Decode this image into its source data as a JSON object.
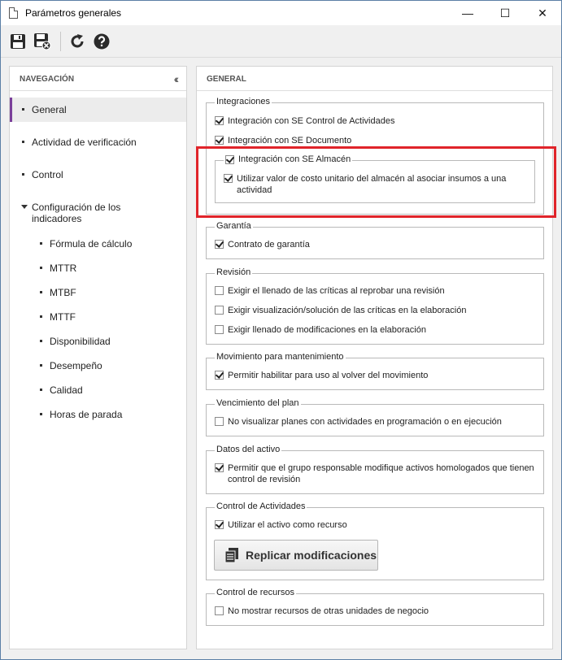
{
  "window": {
    "title": "Parámetros generales",
    "min": "—",
    "max": "☐",
    "close": "✕"
  },
  "toolbar": {
    "save": "save-icon",
    "save_close": "save-close-icon",
    "refresh": "refresh-icon",
    "help": "help-icon"
  },
  "nav": {
    "header": "NAVEGACIÓN",
    "collapse": "«",
    "items": [
      {
        "label": "General"
      },
      {
        "label": "Actividad de verificación"
      },
      {
        "label": "Control"
      },
      {
        "label": "Configuración de los indicadores"
      }
    ],
    "subitems": [
      {
        "label": "Fórmula de cálculo"
      },
      {
        "label": "MTTR"
      },
      {
        "label": "MTBF"
      },
      {
        "label": "MTTF"
      },
      {
        "label": "Disponibilidad"
      },
      {
        "label": "Desempeño"
      },
      {
        "label": "Calidad"
      },
      {
        "label": "Horas de parada"
      }
    ]
  },
  "main": {
    "header": "GENERAL",
    "integraciones": {
      "legend": "Integraciones",
      "items": [
        {
          "label": "Integración con SE Control de Actividades",
          "checked": true
        },
        {
          "label": "Integración con SE Documento",
          "checked": true
        }
      ],
      "almacen": {
        "legend": "Integración con SE Almacén",
        "checked": true,
        "item": {
          "label": "Utilizar valor de costo unitario del almacén al asociar insumos a una actividad",
          "checked": true
        }
      }
    },
    "garantia": {
      "legend": "Garantía",
      "items": [
        {
          "label": "Contrato de garantía",
          "checked": true
        }
      ]
    },
    "revision": {
      "legend": "Revisión",
      "items": [
        {
          "label": "Exigir el llenado de las críticas al reprobar una revisión",
          "checked": false
        },
        {
          "label": "Exigir visualización/solución de las críticas en la elaboración",
          "checked": false
        },
        {
          "label": "Exigir llenado de modificaciones en la elaboración",
          "checked": false
        }
      ]
    },
    "movimiento": {
      "legend": "Movimiento para mantenimiento",
      "items": [
        {
          "label": "Permitir habilitar para uso al volver del movimiento",
          "checked": true
        }
      ]
    },
    "vencimiento": {
      "legend": "Vencimiento del plan",
      "items": [
        {
          "label": "No visualizar planes con actividades en programación o en ejecución",
          "checked": false
        }
      ]
    },
    "datos": {
      "legend": "Datos del activo",
      "items": [
        {
          "label": "Permitir que el grupo responsable modifique activos homologados que tienen control de revisión",
          "checked": true
        }
      ]
    },
    "control_act": {
      "legend": "Control de Actividades",
      "items": [
        {
          "label": "Utilizar el activo como recurso",
          "checked": true
        }
      ],
      "button": "Replicar modificaciones"
    },
    "recursos": {
      "legend": "Control de recursos",
      "items": [
        {
          "label": "No mostrar recursos de otras unidades de negocio",
          "checked": false
        }
      ]
    }
  },
  "colors": {
    "active_accent": "#7a3f9a",
    "highlight": "#e0242a"
  }
}
